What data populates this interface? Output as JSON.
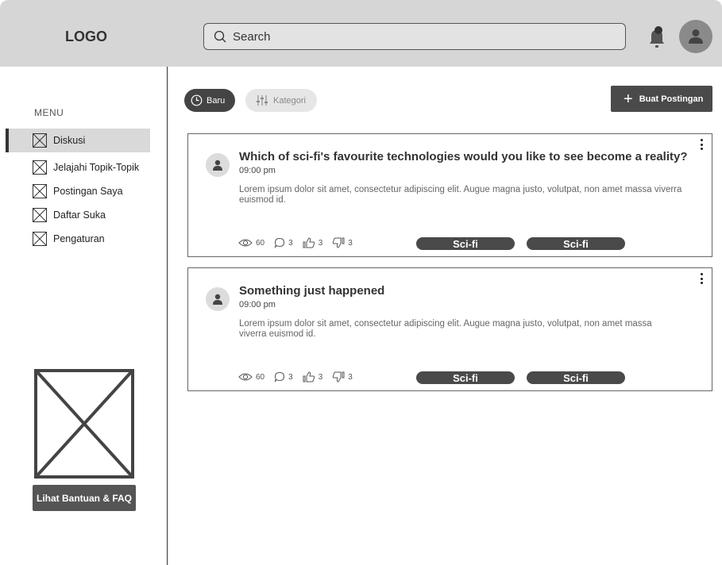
{
  "header": {
    "logo": "LOGO",
    "search_placeholder": "Search"
  },
  "sidebar": {
    "menu_label": "MENU",
    "items": [
      {
        "label": "Diskusi",
        "active": true
      },
      {
        "label": "Jelajahi Topik-Topik",
        "active": false
      },
      {
        "label": "Postingan Saya",
        "active": false
      },
      {
        "label": "Daftar Suka",
        "active": false
      },
      {
        "label": "Pengaturan",
        "active": false
      }
    ],
    "faq_button": "Lihat Bantuan & FAQ"
  },
  "filters": {
    "new_label": "Baru",
    "category_label": "Kategori",
    "create_label": "Buat Postingan"
  },
  "posts": [
    {
      "title": "Which of sci-fi's favourite technologies would you like to see become a reality?",
      "time": "09:00 pm",
      "body": "Lorem ipsum dolor sit amet, consectetur adipiscing elit. Augue magna justo, volutpat, non amet massa viverra euismod id.",
      "views": "60",
      "comments": "3",
      "likes": "3",
      "dislikes": "3",
      "tags": [
        "Sci-fi",
        "Sci-fi"
      ]
    },
    {
      "title": "Something just happened",
      "time": "09:00 pm",
      "body": "Lorem ipsum dolor sit amet, consectetur adipiscing elit. Augue magna justo, volutpat, non amet massa viverra euismod id.",
      "views": "60",
      "comments": "3",
      "likes": "3",
      "dislikes": "3",
      "tags": [
        "Sci-fi",
        "Sci-fi"
      ]
    }
  ],
  "icons": {
    "search": "search-icon",
    "notification": "bell-icon",
    "profile": "user-avatar-icon",
    "nav_item": "placeholder-box-icon",
    "clock": "clock-icon",
    "filter": "sliders-icon",
    "plus": "plus-icon",
    "more": "kebab-menu-icon",
    "views": "eye-icon",
    "comments": "comment-icon",
    "like": "thumbs-up-icon",
    "dislike": "thumbs-down-icon"
  },
  "colors": {
    "header_bg": "#d6d6d6",
    "accent_dark": "#4a4a4a",
    "active_item_bg": "#d9d9d9"
  }
}
